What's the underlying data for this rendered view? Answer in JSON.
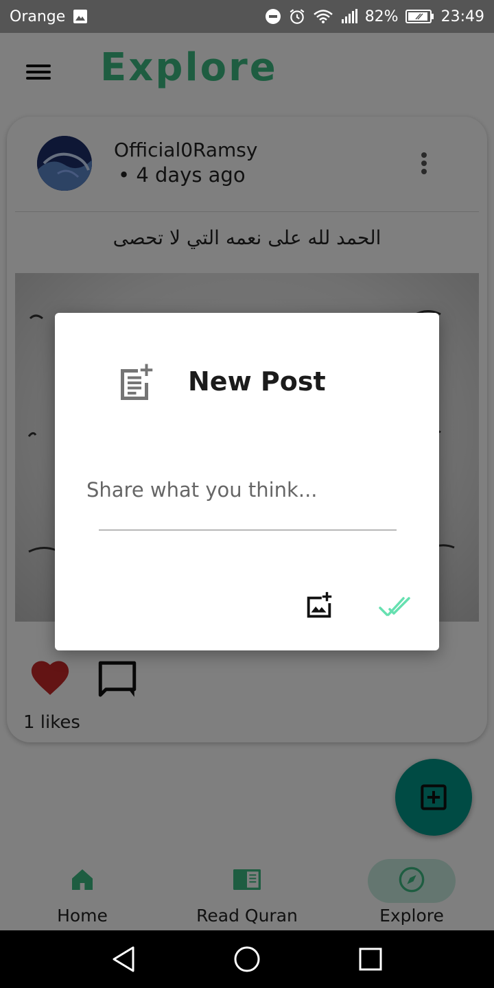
{
  "status_bar": {
    "carrier": "Orange",
    "battery": "82%",
    "time": "23:49"
  },
  "header": {
    "title": "Explore"
  },
  "post": {
    "username": "Official0Ramsy",
    "time_ago": "• 4 days ago",
    "text": "الحمد لله على نعمه التي لا تحصى",
    "likes": "1 likes"
  },
  "bottom_nav": {
    "items": [
      {
        "label": "Home",
        "icon": "home-icon"
      },
      {
        "label": "Read Quran",
        "icon": "book-icon"
      },
      {
        "label": "Explore",
        "icon": "compass-icon",
        "active": true
      }
    ]
  },
  "dialog": {
    "title": "New Post",
    "placeholder": "Share what you think..."
  },
  "colors": {
    "accent": "#3dbb83",
    "fab": "#009688",
    "like": "#c62828",
    "done": "#66e0b0"
  }
}
